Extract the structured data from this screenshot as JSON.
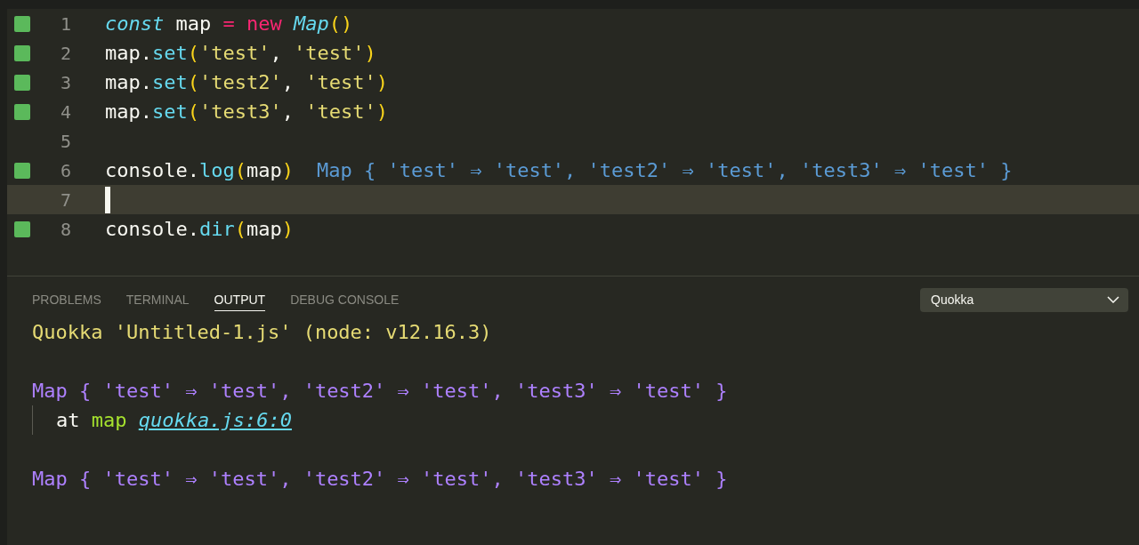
{
  "editor": {
    "lines": [
      {
        "number": "1",
        "covered": true,
        "current": false,
        "tokens": [
          {
            "text": "const",
            "kind": "keyword"
          },
          {
            "text": " map ",
            "kind": "ident"
          },
          {
            "text": "=",
            "kind": "operator"
          },
          {
            "text": " new",
            "kind": "operator"
          },
          {
            "text": " Map",
            "kind": "keyword"
          },
          {
            "text": "()",
            "kind": "paren"
          }
        ]
      },
      {
        "number": "2",
        "covered": true,
        "current": false,
        "tokens": [
          {
            "text": "map.",
            "kind": "ident"
          },
          {
            "text": "set",
            "kind": "method"
          },
          {
            "text": "(",
            "kind": "paren"
          },
          {
            "text": "'test'",
            "kind": "string"
          },
          {
            "text": ", ",
            "kind": "ident"
          },
          {
            "text": "'test'",
            "kind": "string"
          },
          {
            "text": ")",
            "kind": "paren"
          }
        ]
      },
      {
        "number": "3",
        "covered": true,
        "current": false,
        "tokens": [
          {
            "text": "map.",
            "kind": "ident"
          },
          {
            "text": "set",
            "kind": "method"
          },
          {
            "text": "(",
            "kind": "paren"
          },
          {
            "text": "'test2'",
            "kind": "string"
          },
          {
            "text": ", ",
            "kind": "ident"
          },
          {
            "text": "'test'",
            "kind": "string"
          },
          {
            "text": ")",
            "kind": "paren"
          }
        ]
      },
      {
        "number": "4",
        "covered": true,
        "current": false,
        "tokens": [
          {
            "text": "map.",
            "kind": "ident"
          },
          {
            "text": "set",
            "kind": "method"
          },
          {
            "text": "(",
            "kind": "paren"
          },
          {
            "text": "'test3'",
            "kind": "string"
          },
          {
            "text": ", ",
            "kind": "ident"
          },
          {
            "text": "'test'",
            "kind": "string"
          },
          {
            "text": ")",
            "kind": "paren"
          }
        ]
      },
      {
        "number": "5",
        "covered": false,
        "current": false
      },
      {
        "number": "6",
        "covered": true,
        "current": false,
        "tokens": [
          {
            "text": "console.",
            "kind": "ident"
          },
          {
            "text": "log",
            "kind": "method"
          },
          {
            "text": "(",
            "kind": "paren"
          },
          {
            "text": "map",
            "kind": "ident"
          },
          {
            "text": ")",
            "kind": "paren"
          }
        ],
        "inline_result": "Map { 'test' ⇒ 'test', 'test2' ⇒ 'test', 'test3' ⇒ 'test' }"
      },
      {
        "number": "7",
        "covered": false,
        "current": true
      },
      {
        "number": "8",
        "covered": true,
        "current": false,
        "tokens": [
          {
            "text": "console.",
            "kind": "ident"
          },
          {
            "text": "dir",
            "kind": "method"
          },
          {
            "text": "(",
            "kind": "paren"
          },
          {
            "text": "map",
            "kind": "ident"
          },
          {
            "text": ")",
            "kind": "paren"
          }
        ]
      }
    ]
  },
  "panel": {
    "tabs": [
      {
        "label": "PROBLEMS",
        "selected": false
      },
      {
        "label": "TERMINAL",
        "selected": false
      },
      {
        "label": "OUTPUT",
        "selected": true
      },
      {
        "label": "DEBUG CONSOLE",
        "selected": false
      }
    ],
    "channel_select": {
      "value": "Quokka"
    },
    "output": [
      {
        "kind": "header",
        "text": "Quokka 'Untitled-1.js' (node: v12.16.3)"
      },
      {
        "kind": "blank"
      },
      {
        "kind": "value",
        "text": "Map { 'test' ⇒ 'test', 'test2' ⇒ 'test', 'test3' ⇒ 'test' }"
      },
      {
        "kind": "trace",
        "prefix": "at",
        "function": "map",
        "link": "quokka.js:6:0"
      },
      {
        "kind": "blank"
      },
      {
        "kind": "value",
        "text": "Map { 'test' ⇒ 'test', 'test2' ⇒ 'test', 'test3' ⇒ 'test' }"
      }
    ]
  }
}
